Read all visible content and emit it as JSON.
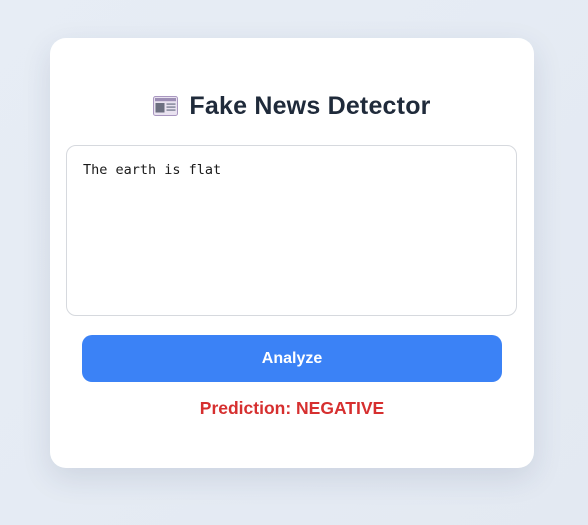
{
  "header": {
    "icon": "newspaper-icon",
    "title": "Fake News Detector"
  },
  "input": {
    "value": "The earth is flat",
    "placeholder": ""
  },
  "actions": {
    "analyze_label": "Analyze"
  },
  "result": {
    "text": "Prediction: NEGATIVE"
  },
  "colors": {
    "accent": "#3b82f6",
    "negative": "#d62f2f",
    "title": "#1f2a3a",
    "background": "#e5ebf3"
  }
}
